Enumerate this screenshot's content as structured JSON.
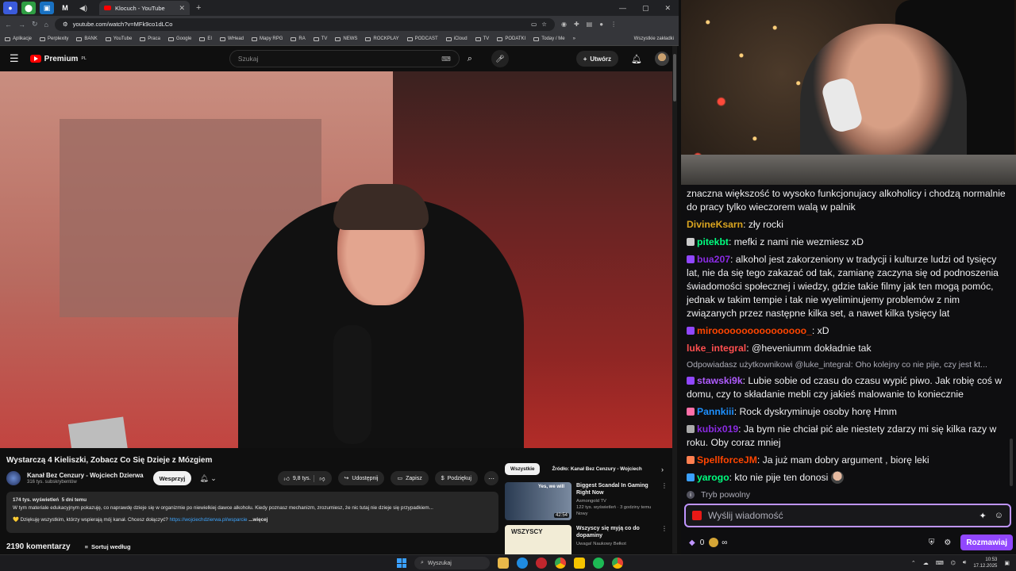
{
  "browser": {
    "tab_title": "Klocuch - YouTube",
    "url": "youtube.com/watch?v=MFk9co1dLCo",
    "window_controls": [
      "—",
      "▢",
      "✕"
    ],
    "bookmarks": [
      "Aplikacje",
      "Perplexity",
      "BANK",
      "YouTube",
      "Praca",
      "Google",
      "EI",
      "WHead",
      "Mapy RPG",
      "RA",
      "TV",
      "NEWS",
      "ROCKPLAY",
      "PODCAST",
      "iCloud",
      "TV",
      "PODATKI",
      "Today / Me"
    ],
    "all_bookmarks": "Wszystkie zakładki"
  },
  "youtube": {
    "logo_text": "Premium",
    "logo_sup": "PL",
    "search_placeholder": "Szukaj",
    "create_label": "Utwórz",
    "video": {
      "title": "Wystarczą 4 Kieliszki, Zobacz Co Się Dzieje z Mózgiem",
      "channel": "Kanał Bez Cenzury - Wojciech Dzierwa",
      "subscribers": "316 tys. subskrybentów",
      "support_label": "Wesprzyj",
      "likes": "9,8 tys.",
      "share_label": "Udostępnij",
      "save_label": "Zapisz",
      "thanks_label": "Podziękuj",
      "views": "174 tys. wyświetleń",
      "age": "5 dni temu",
      "description": "W tym materiale edukacyjnym pokazuję, co naprawdę dzieje się w organizmie po niewielkiej dawce alkoholu. Kiedy poznasz mechanizm, zrozumiesz, że nic tutaj nie dzieje się przypadkiem...",
      "thanks_line": "💛 Dziękuję wszystkim, którzy wspierają mój kanał. Chcesz dołączyć?",
      "link": "https://wojciechdzierwa.pl/wsparcie",
      "more_label": "...więcej",
      "comments_count": "2190 komentarzy",
      "sort_label": "Sortuj według"
    },
    "chips": [
      "Wszystkie",
      "Źródło: Kanał Bez Cenzury - Wojciech Dzierwa"
    ],
    "recommendations": [
      {
        "title": "Biggest Scandal In Gaming Right Now",
        "channel": "Asmongold TV",
        "meta": "122 tys. wyświetleń · 3 godziny temu",
        "badge": "Nowy",
        "duration": "42:54",
        "thumb_text": "Yes, we will",
        "thumb_color": "#2a3b52"
      },
      {
        "title": "Wszyscy się myją co do dopaminy",
        "channel": "Uwaga! Naukowy Bełkot",
        "meta": "",
        "badge": "",
        "duration": "",
        "thumb_text": "WSZYSCY",
        "thumb_color": "#f2ecd6"
      }
    ]
  },
  "chat": {
    "messages": [
      {
        "user": "",
        "color": "#ff4f4f",
        "text": "znaczna większość to wysoko funkcjonujacy alkoholicy i chodzą normalnie do pracy tylko wieczorem walą w palnik",
        "badge": ""
      },
      {
        "user": "DivineKsarn",
        "color": "#daa520",
        "text": ": zły rocki",
        "badge": ""
      },
      {
        "user": "pitekbt",
        "color": "#00ff7f",
        "text": ": mefki z nami nie wezmiesz xD",
        "badge": "#cccccc"
      },
      {
        "user": "bua207",
        "color": "#8a2be2",
        "text": ": alkohol jest zakorzeniony w tradycji i kulturze ludzi od tysięcy lat, nie da się tego zakazać od tak, zamianę zaczyna się od podnoszenia świadomości społecznej i wiedzy, gdzie takie filmy jak ten mogą pomóc, jednak w takim tempie i tak nie wyeliminujemy problemów z nim związanych przez następne kilka set, a nawet kilka tysięcy lat",
        "badge": "#9147ff"
      },
      {
        "user": "miroooooooooooooooo_",
        "color": "#ff4500",
        "text": ": xD",
        "badge": "#9147ff"
      },
      {
        "user": "luke_integral",
        "color": "#ff4f4f",
        "text": ": @heveniumm dokładnie tak",
        "badge": ""
      },
      {
        "user": "stawski9k",
        "color": "#b05cff",
        "text": ": Lubie sobie od czasu do czasu wypić piwo. Jak robię coś w domu, czy to składanie mebli czy jakieś malowanie to koniecznie",
        "badge": "#9147ff",
        "reply": "Odpowiadasz użytkownikowi @luke_integral: Oho kolejny co nie pije, czy jest kt..."
      },
      {
        "user": "Pannkiii",
        "color": "#1e90ff",
        "text": ": Rock dyskryminuje osoby horę Hmm",
        "badge": "#ff6fa8"
      },
      {
        "user": "kubix019",
        "color": "#8a2be2",
        "text": ": Ja bym nie chciał pić ale niestety zdarzy mi się kilka razy w roku. Oby coraz mniej",
        "badge": "#aaaaaa"
      },
      {
        "user": "SpellforceJM",
        "color": "#ff4500",
        "text": ": Ja już mam dobry argument , biorę leki",
        "badge": "#ff7f50"
      },
      {
        "user": "yarogo",
        "color": "#00ff7f",
        "text": ": kto nie pije ten donosi",
        "badge": "#3aa0ff"
      }
    ],
    "slow_mode": "Tryb powolny",
    "input_placeholder": "Wyślij wiadomość",
    "points": "0",
    "infinity": "∞",
    "talk_button": "Rozmawiaj"
  },
  "taskbar": {
    "search_placeholder": "Wyszukaj",
    "time": "10:53",
    "date": "17.12.2025"
  }
}
